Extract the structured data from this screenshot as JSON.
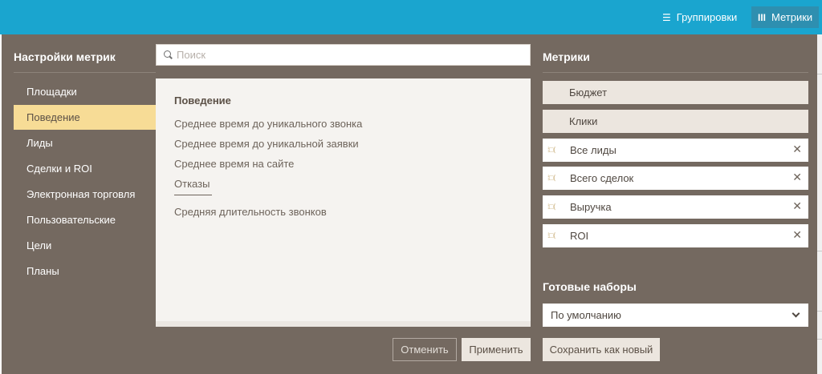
{
  "topbar": {
    "groupings_label": "Группировки",
    "metrics_label": "Метрики"
  },
  "settings": {
    "title": "Настройки метрик",
    "nav": [
      {
        "label": "Площадки"
      },
      {
        "label": "Поведение",
        "active": true
      },
      {
        "label": "Лиды"
      },
      {
        "label": "Сделки и ROI"
      },
      {
        "label": "Электронная торговля"
      },
      {
        "label": "Пользовательские"
      },
      {
        "label": "Цели"
      },
      {
        "label": "Планы"
      }
    ]
  },
  "search": {
    "placeholder": "Поиск",
    "value": ""
  },
  "list": {
    "heading": "Поведение",
    "items": [
      "Среднее время до уникального звонка",
      "Среднее время до уникальной заявки",
      "Среднее время на сайте",
      "Отказы"
    ],
    "extra_items": [
      "Средняя длительность звонков"
    ]
  },
  "buttons": {
    "cancel": "Отменить",
    "apply": "Применить",
    "save_new": "Сохранить как новый"
  },
  "metrics": {
    "title": "Метрики",
    "fixed": [
      "Бюджет",
      "Клики"
    ],
    "removable": [
      "Все лиды",
      "Всего сделок",
      "Выручка",
      "ROI"
    ]
  },
  "presets": {
    "title": "Готовые наборы",
    "selected": "По умолчанию"
  },
  "colors": {
    "topbar": "#1aa5cf",
    "panel": "#746960",
    "active_nav": "#f7dc96"
  }
}
